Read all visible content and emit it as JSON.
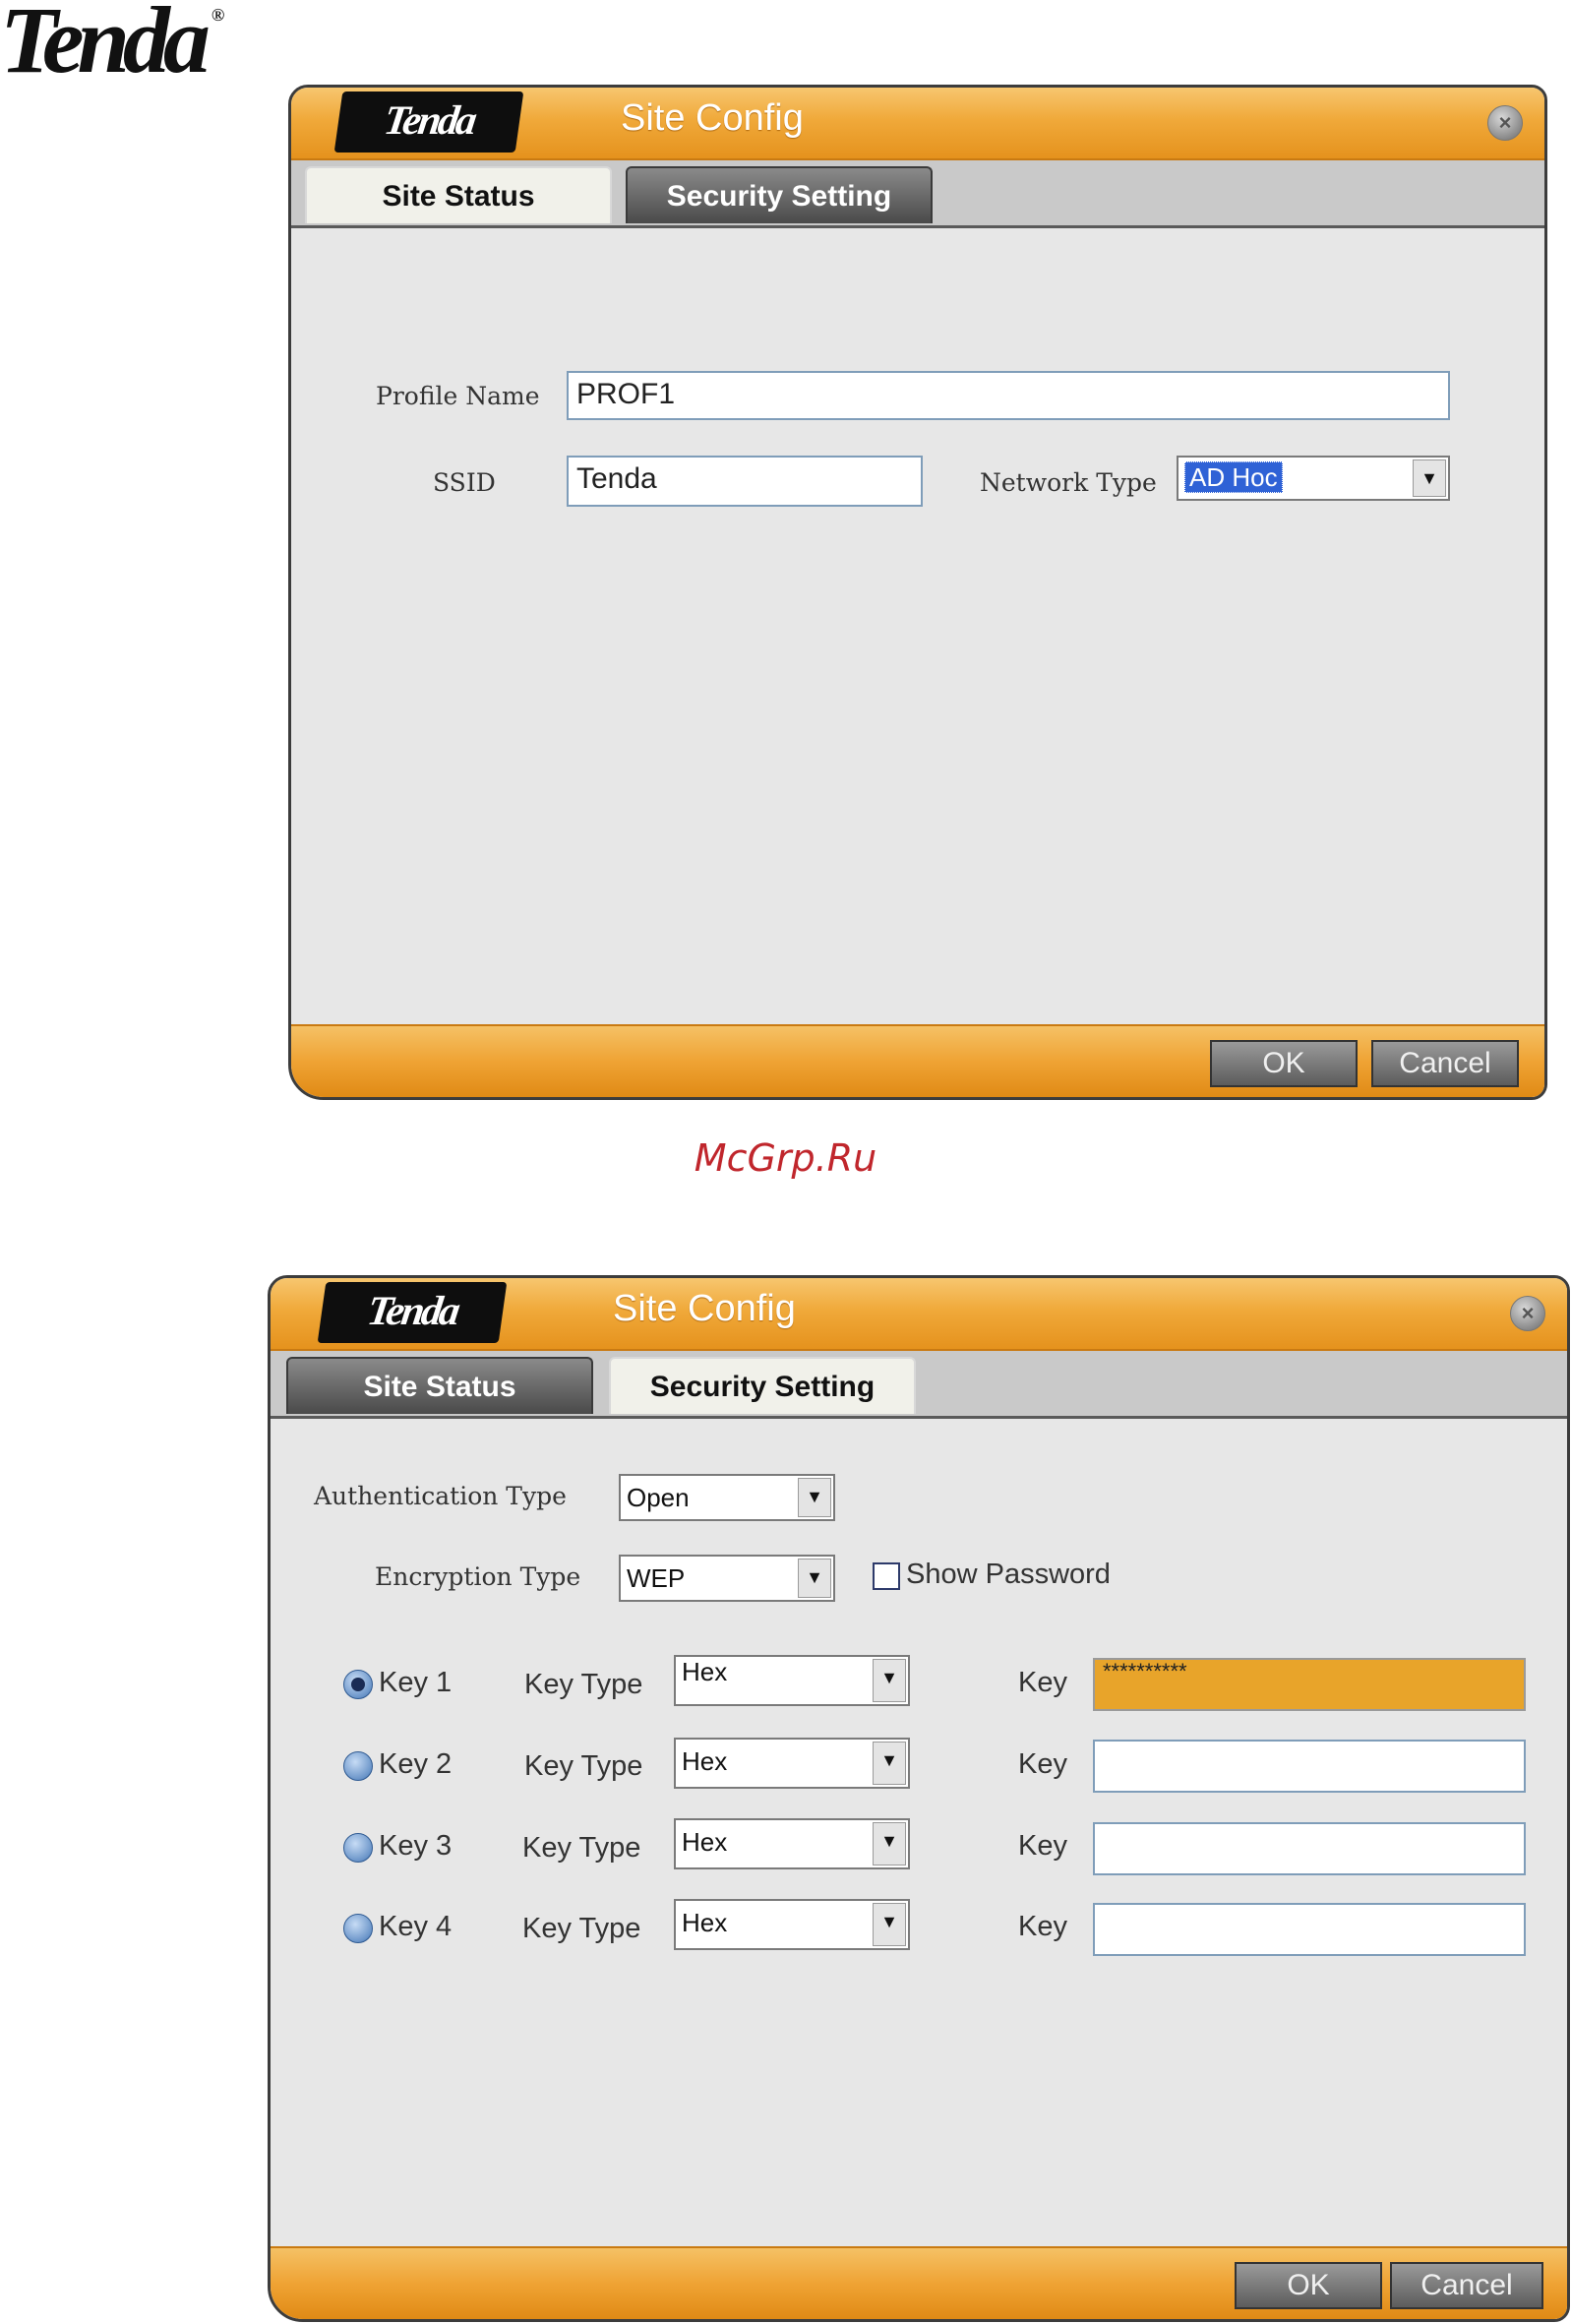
{
  "page": {
    "logo_text": "Tenda",
    "logo_mark": "®",
    "watermark": "McGrp.Ru"
  },
  "colors": {
    "accent_orange": "#efa334",
    "tab_dark": "#4a4a4a",
    "selection_blue": "#2f62d6",
    "active_key_field": "#e8a42a"
  },
  "windows": [
    {
      "brand": "Tenda",
      "title": "Site Config",
      "tabs": [
        {
          "label": "Site Status",
          "active": true
        },
        {
          "label": "Security Setting",
          "active": false
        }
      ],
      "fields": {
        "profile_name_label": "Profile Name",
        "profile_name_value": "PROF1",
        "ssid_label": "SSID",
        "ssid_value": "Tenda",
        "network_type_label": "Network Type",
        "network_type_value": "AD Hoc"
      },
      "buttons": {
        "ok": "OK",
        "cancel": "Cancel"
      }
    },
    {
      "brand": "Tenda",
      "title": "Site Config",
      "tabs": [
        {
          "label": "Site Status",
          "active": false
        },
        {
          "label": "Security Setting",
          "active": true
        }
      ],
      "fields": {
        "auth_type_label": "Authentication Type",
        "auth_type_value": "Open",
        "enc_type_label": "Encryption Type",
        "enc_type_value": "WEP",
        "show_password_label": "Show Password",
        "show_password_checked": false
      },
      "keys": [
        {
          "label": "Key 1",
          "selected": true,
          "key_type_label": "Key Type",
          "key_type": "Hex",
          "key_label": "Key",
          "key_value": "**********"
        },
        {
          "label": "Key 2",
          "selected": false,
          "key_type_label": "Key Type",
          "key_type": "Hex",
          "key_label": "Key",
          "key_value": ""
        },
        {
          "label": "Key 3",
          "selected": false,
          "key_type_label": "Key Type",
          "key_type": "Hex",
          "key_label": "Key",
          "key_value": ""
        },
        {
          "label": "Key 4",
          "selected": false,
          "key_type_label": "Key Type",
          "key_type": "Hex",
          "key_label": "Key",
          "key_value": ""
        }
      ],
      "buttons": {
        "ok": "OK",
        "cancel": "Cancel"
      }
    }
  ]
}
